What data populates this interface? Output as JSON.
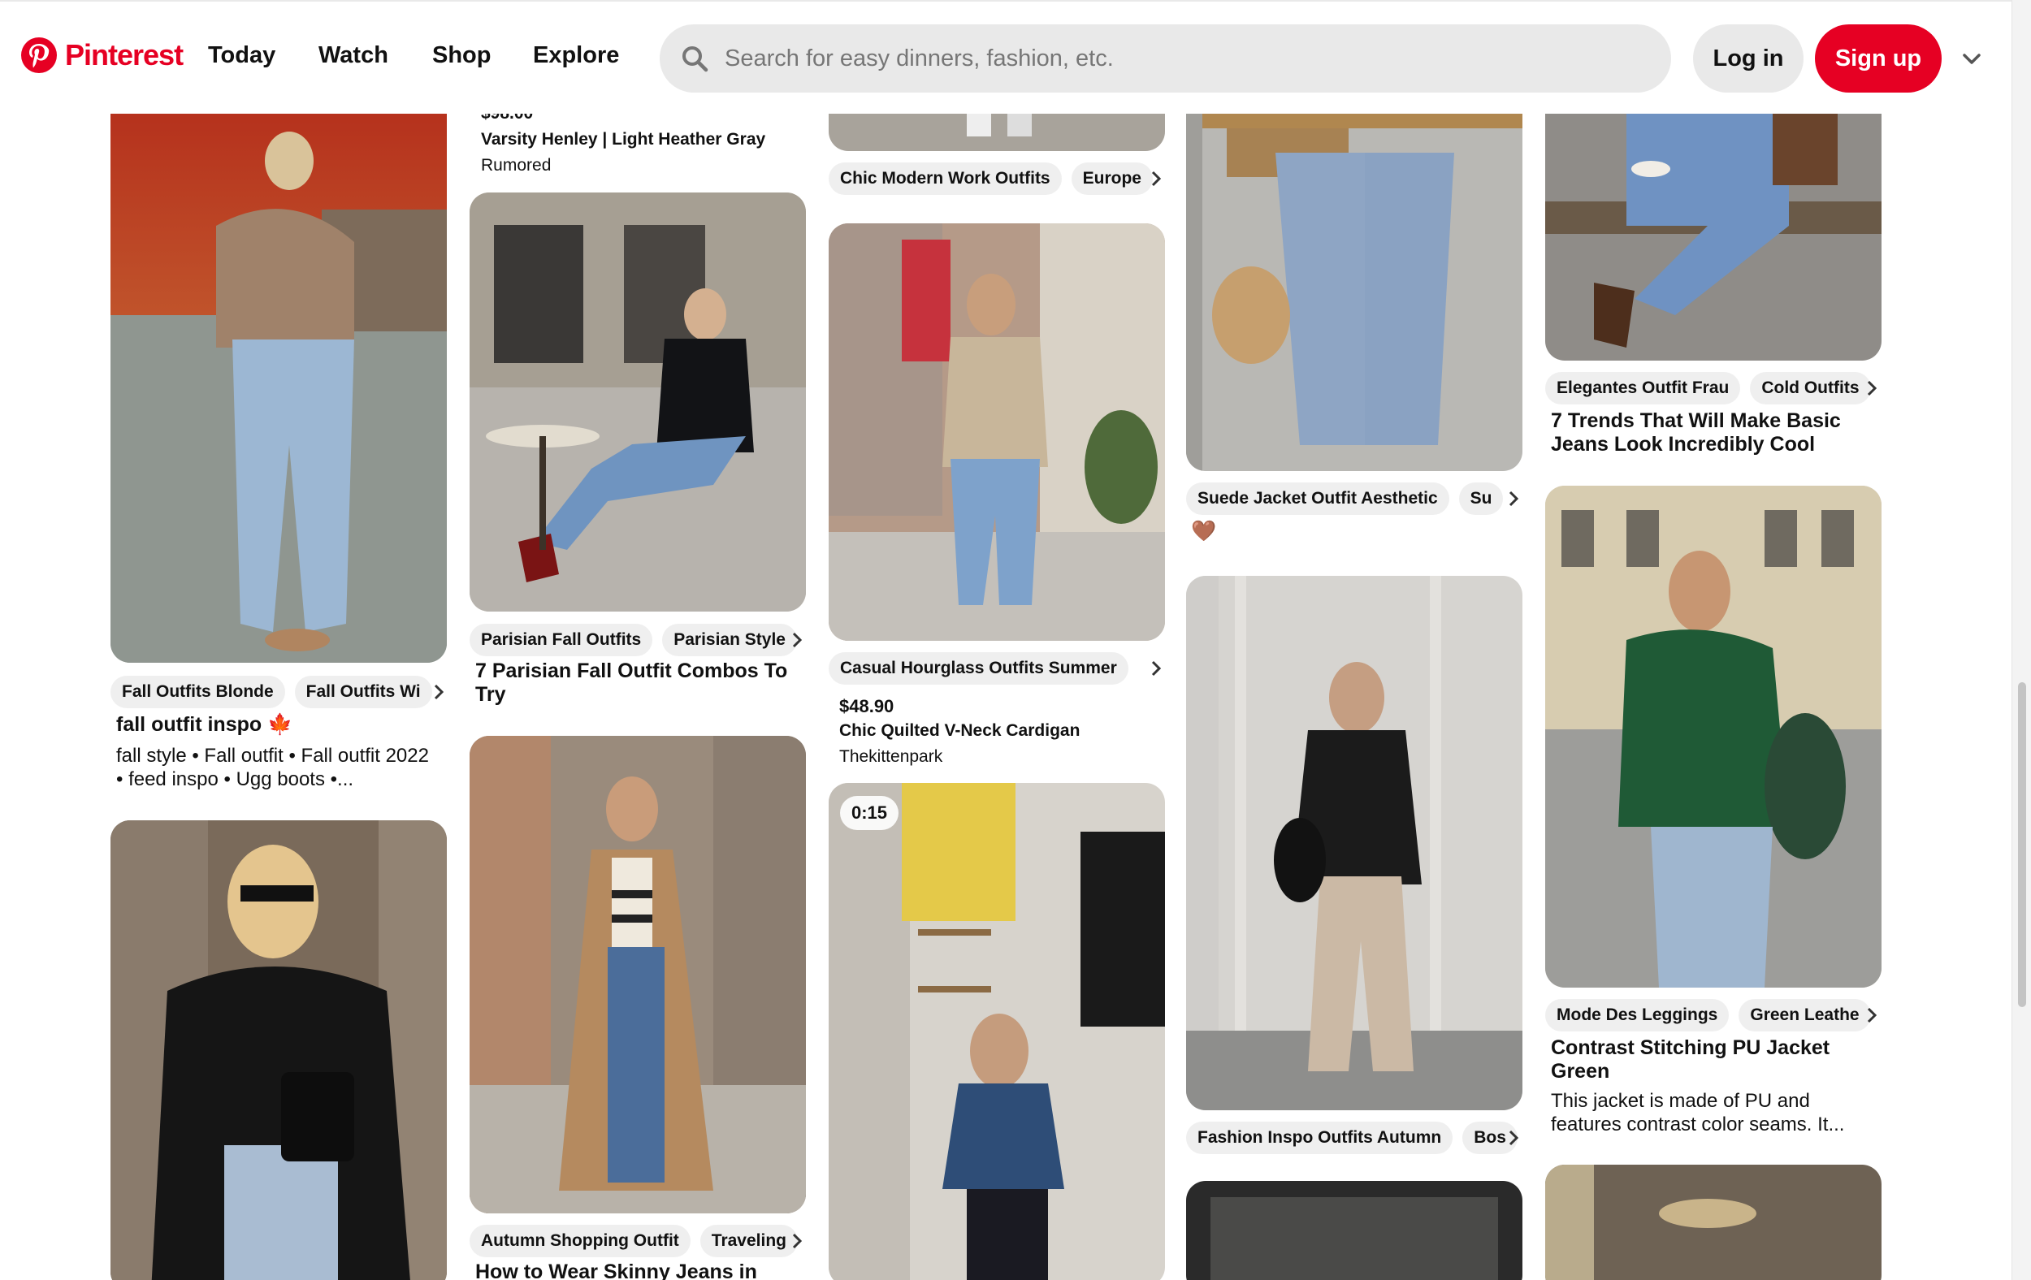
{
  "header": {
    "brand": "Pinterest",
    "nav": [
      "Today",
      "Watch",
      "Shop",
      "Explore"
    ],
    "search_placeholder": "Search for easy dinners, fashion, etc.",
    "login": "Log in",
    "signup": "Sign up",
    "brand_color": "#e60023"
  },
  "col1": {
    "pin1": {
      "chips": [
        "Fall Outfits Blonde",
        "Fall Outfits Wi"
      ],
      "title": "fall outfit inspo",
      "emoji": "🍁",
      "desc": "fall style • Fall outfit • Fall outfit 2022 • feed inspo • Ugg boots •..."
    }
  },
  "col2": {
    "pin0": {
      "price": "$98.00",
      "title": "Varsity Henley | Light Heather Gray",
      "source": "Rumored"
    },
    "pin1": {
      "chips": [
        "Parisian Fall Outfits",
        "Parisian Style"
      ],
      "title": "7 Parisian Fall Outfit Combos To Try"
    },
    "pin2": {
      "chips": [
        "Autumn Shopping Outfit",
        "Traveling"
      ],
      "title": "How to Wear Skinny Jeans in"
    }
  },
  "col3": {
    "pin0": {
      "chips": [
        "Chic Modern Work Outfits",
        "Europe"
      ]
    },
    "pin1": {
      "chips": [
        "Casual Hourglass Outfits Summer"
      ],
      "price": "$48.90",
      "title": "Chic Quilted V-Neck Cardigan",
      "source": "Thekittenpark"
    },
    "pin2": {
      "video_time": "0:15"
    }
  },
  "col4": {
    "pin0": {
      "chips": [
        "Suede Jacket Outfit Aesthetic",
        "Su"
      ],
      "emoji": "🤎"
    },
    "pin1": {
      "chips": [
        "Fashion Inspo Outfits Autumn",
        "Bos"
      ]
    }
  },
  "col5": {
    "pin0": {
      "chips": [
        "Elegantes Outfit Frau",
        "Cold Outfits"
      ],
      "title": "7 Trends That Will Make Basic Jeans Look Incredibly Cool"
    },
    "pin1": {
      "chips": [
        "Mode Des Leggings",
        "Green Leathe"
      ],
      "title": "Contrast Stitching PU Jacket Green",
      "desc": "This jacket is made of PU and features contrast color seams. It..."
    }
  }
}
